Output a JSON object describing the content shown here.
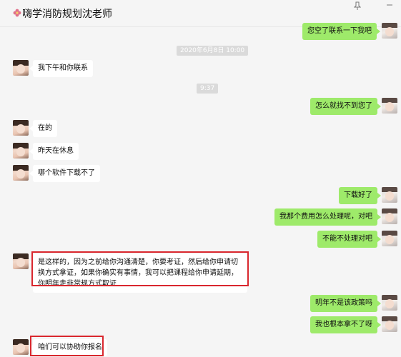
{
  "window": {
    "title": "嗨学消防规划沈老师",
    "pin_icon": "pin-icon",
    "min_icon": "minimize-icon",
    "colors": {
      "incoming_bubble": "#ffffff",
      "outgoing_bubble": "#9eea6a",
      "highlight": "#d9272e",
      "background": "#f5f5f5"
    }
  },
  "timestamps": [
    "2020年6月8日 10:00",
    "9:37"
  ],
  "messages": [
    {
      "side": "out",
      "text": "您空了联系一下我吧"
    },
    {
      "side": "in",
      "text": "我下午和你联系"
    },
    {
      "side": "out",
      "text": "怎么就找不到您了"
    },
    {
      "side": "in",
      "text": "在的"
    },
    {
      "side": "in",
      "text": "昨天在休息"
    },
    {
      "side": "in",
      "text": "哪个软件下载不了"
    },
    {
      "side": "out",
      "text": "下载好了"
    },
    {
      "side": "out",
      "text": "我那个费用怎么处理呢，对吧"
    },
    {
      "side": "out",
      "text": "不能不处理对吧"
    },
    {
      "side": "in",
      "text": "是这样的，因为之前给你沟通清楚，你要考证，然后给你申请切换方式拿证，如果你确实有事情，我可以把课程给你申请延期，你明年走非常规方式取证"
    },
    {
      "side": "out",
      "text": "明年不是该政策吗"
    },
    {
      "side": "out",
      "text": "我也根本拿不了呀"
    },
    {
      "side": "in",
      "text": "咱们可以协助你报名"
    }
  ]
}
